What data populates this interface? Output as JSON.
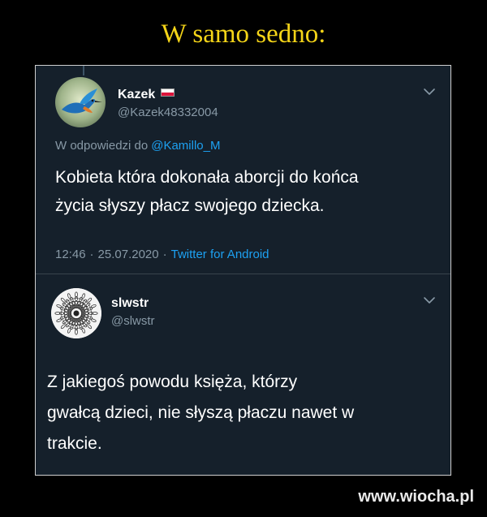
{
  "meme_title": "W samo sedno:",
  "colors": {
    "title": "#f4d418",
    "tweet_background": "#15202b",
    "link": "#1da1f2",
    "muted_text": "#8899a6"
  },
  "tweets": [
    {
      "display_name": "Kazek",
      "name_badge_icon": "poland-flag-icon",
      "handle": "@Kazek48332004",
      "reply_prefix": "W odpowiedzi do",
      "reply_mention": "@Kamillo_M",
      "text": "Kobieta która dokonała aborcji do końca\nżycia słyszy płacz swojego dziecka.",
      "time": "12:46",
      "separator": "·",
      "date": "25.07.2020",
      "source": "Twitter for Android",
      "menu_icon": "chevron-down-icon",
      "avatar_icon": "kingfisher-bird-avatar"
    },
    {
      "display_name": "slwstr",
      "handle": "@slwstr",
      "text": "Z jakiegoś powodu księża, którzy\ngwałcą dzieci, nie słyszą płaczu nawet w\ntrakcie.",
      "menu_icon": "chevron-down-icon",
      "avatar_icon": "mandala-avatar"
    }
  ],
  "watermark": "www.wiocha.pl"
}
